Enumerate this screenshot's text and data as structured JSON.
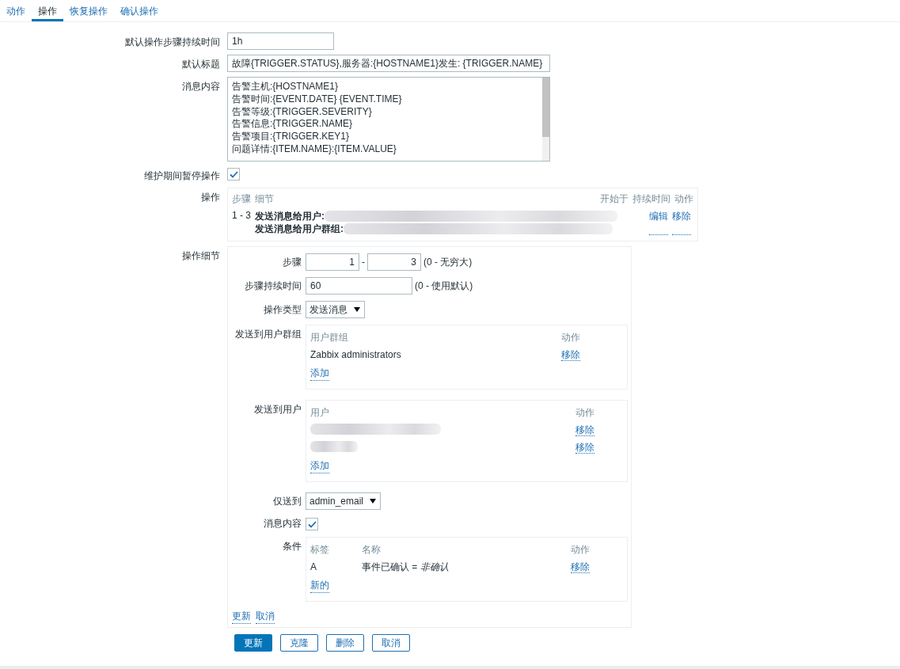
{
  "tabs": [
    {
      "label": "动作",
      "selected": false
    },
    {
      "label": "操作",
      "selected": true
    },
    {
      "label": "恢复操作",
      "selected": false
    },
    {
      "label": "确认操作",
      "selected": false
    }
  ],
  "default_step_duration": {
    "label": "默认操作步骤持续时间",
    "value": "1h"
  },
  "default_subject": {
    "label": "默认标题",
    "value": "故障{TRIGGER.STATUS},服务器:{HOSTNAME1}发生: {TRIGGER.NAME}"
  },
  "default_message": {
    "label": "消息内容",
    "lines": [
      "告警主机:{HOSTNAME1}",
      "告警时间:{EVENT.DATE} {EVENT.TIME}",
      "告警等级:{TRIGGER.SEVERITY}",
      "告警信息:{TRIGGER.NAME}",
      "告警项目:{TRIGGER.KEY1}",
      "问题详情:{ITEM.NAME}:{ITEM.VALUE}"
    ]
  },
  "pause_in_maintenance": {
    "label": "维护期间暂停操作",
    "checked": true
  },
  "operations": {
    "label": "操作",
    "columns": [
      "步骤",
      "细节",
      "开始于",
      "持续时间",
      "动作"
    ],
    "rows": [
      {
        "steps": "1 - 3",
        "details": [
          "发送消息给用户:",
          "发送消息给用户群组:"
        ],
        "actions": [
          "编辑",
          "移除"
        ]
      }
    ]
  },
  "operation_details": {
    "label": "操作细节",
    "steps": {
      "label": "步骤",
      "from": "1",
      "separator": "-",
      "to": "3",
      "hint": "(0 - 无穷大)"
    },
    "step_duration": {
      "label": "步骤持续时间",
      "value": "60",
      "hint": "(0 - 使用默认)"
    },
    "operation_type": {
      "label": "操作类型",
      "value": "发送消息"
    },
    "send_to_groups": {
      "label": "发送到用户群组",
      "columns": [
        "用户群组",
        "动作"
      ],
      "rows": [
        {
          "name": "Zabbix administrators",
          "action": "移除"
        }
      ],
      "add": "添加"
    },
    "send_to_users": {
      "label": "发送到用户",
      "columns": [
        "用户",
        "动作"
      ],
      "rows": [
        {
          "action": "移除"
        },
        {
          "action": "移除"
        }
      ],
      "add": "添加"
    },
    "send_only_to": {
      "label": "仅送到",
      "value": "admin_email"
    },
    "message_content": {
      "label": "消息内容",
      "checked": true
    },
    "conditions": {
      "label": "条件",
      "columns": [
        "标签",
        "名称",
        "动作"
      ],
      "rows": [
        {
          "tag": "A",
          "name": "事件已确认 = *非确认*",
          "action": "移除"
        }
      ],
      "add": "新的"
    },
    "links": [
      "更新",
      "取消"
    ]
  },
  "buttons": [
    {
      "label": "更新",
      "primary": true
    },
    {
      "label": "克隆",
      "primary": false
    },
    {
      "label": "删除",
      "primary": false
    },
    {
      "label": "取消",
      "primary": false
    }
  ]
}
